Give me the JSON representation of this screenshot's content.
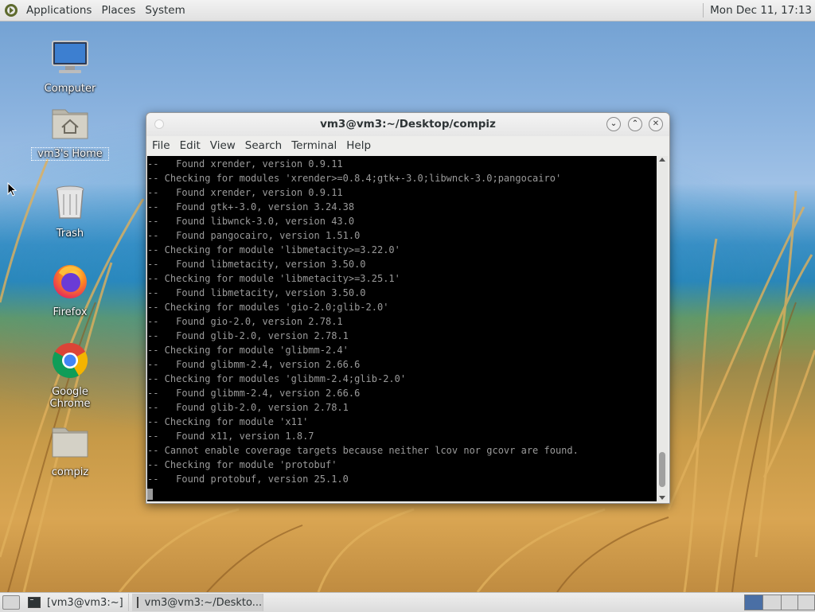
{
  "top_panel": {
    "menus": [
      "Applications",
      "Places",
      "System"
    ],
    "clock": "Mon Dec 11, 17:13"
  },
  "desktop_icons": [
    {
      "label": "Computer",
      "icon": "computer-icon"
    },
    {
      "label": "vm3's Home",
      "icon": "home-folder-icon"
    },
    {
      "label": "Trash",
      "icon": "trash-icon"
    },
    {
      "label": "Firefox",
      "icon": "firefox-icon"
    },
    {
      "label": "Google Chrome",
      "icon": "chrome-icon"
    },
    {
      "label": "compiz",
      "icon": "folder-icon"
    }
  ],
  "window": {
    "title": "vm3@vm3:~/Desktop/compiz",
    "menus": [
      "File",
      "Edit",
      "View",
      "Search",
      "Terminal",
      "Help"
    ],
    "terminal_lines": [
      "--   Found xrender, version 0.9.11",
      "-- Checking for modules 'xrender>=0.8.4;gtk+-3.0;libwnck-3.0;pangocairo'",
      "--   Found xrender, version 0.9.11",
      "--   Found gtk+-3.0, version 3.24.38",
      "--   Found libwnck-3.0, version 43.0",
      "--   Found pangocairo, version 1.51.0",
      "-- Checking for module 'libmetacity>=3.22.0'",
      "--   Found libmetacity, version 3.50.0",
      "-- Checking for module 'libmetacity>=3.25.1'",
      "--   Found libmetacity, version 3.50.0",
      "-- Checking for modules 'gio-2.0;glib-2.0'",
      "--   Found gio-2.0, version 2.78.1",
      "--   Found glib-2.0, version 2.78.1",
      "-- Checking for module 'glibmm-2.4'",
      "--   Found glibmm-2.4, version 2.66.6",
      "-- Checking for modules 'glibmm-2.4;glib-2.0'",
      "--   Found glibmm-2.4, version 2.66.6",
      "--   Found glib-2.0, version 2.78.1",
      "-- Checking for module 'x11'",
      "--   Found x11, version 1.8.7",
      "-- Cannot enable coverage targets because neither lcov nor gcovr are found.",
      "-- Checking for module 'protobuf'",
      "--   Found protobuf, version 25.1.0"
    ]
  },
  "taskbar": {
    "tasks": [
      {
        "label": "[vm3@vm3:~]",
        "active": false
      },
      {
        "label": "vm3@vm3:~/Deskto...",
        "active": true
      }
    ]
  },
  "colors": {
    "terminal_bg": "#000000",
    "terminal_fg": "#9a9a9a",
    "panel_bg": "#e6e6e6"
  }
}
